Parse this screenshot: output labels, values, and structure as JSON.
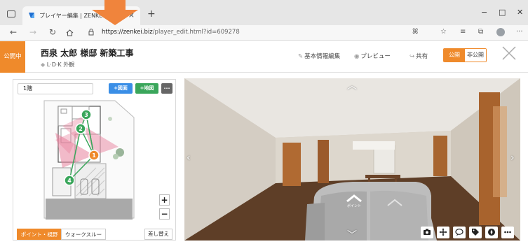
{
  "browser": {
    "tab_title": "プレイヤー編集 | ZENKEI",
    "url_host": "https://zenkei.biz",
    "url_path": "/player_edit.html?id=609278"
  },
  "header": {
    "status_badge": "公開中",
    "title": "西泉 太郎 様邸 新築工事",
    "tag": "L·D·K 外観",
    "links": {
      "basic_info": "基本情報編集",
      "preview": "プレビュー",
      "share": "共有"
    },
    "toggle": {
      "public": "公開",
      "private": "非公開"
    }
  },
  "left_panel": {
    "floor_select": "1階",
    "add_plan_button": "+図面",
    "add_map_button": "+地図",
    "more_button": "···",
    "zoom_in": "+",
    "zoom_out": "−",
    "points": [
      "1",
      "2",
      "3",
      "4"
    ],
    "mode_point": "ポイント・視野",
    "mode_walk": "ウォークスルー",
    "replace_button": "差し替え"
  },
  "viewer": {
    "hotspot_label": "ポイント"
  },
  "colors": {
    "accent": "#ef8a2b",
    "blue": "#3a8ee6",
    "green": "#3aa65b"
  }
}
